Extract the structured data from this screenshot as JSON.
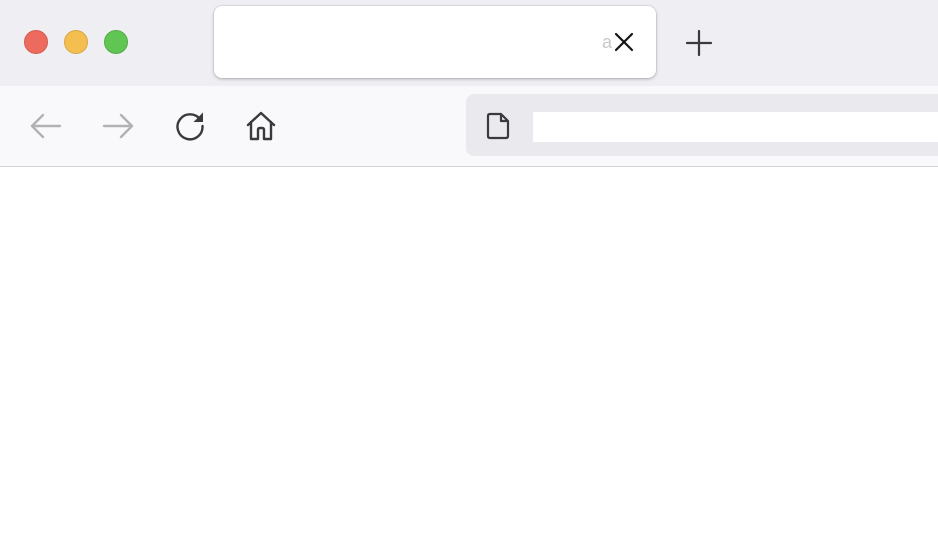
{
  "window": {
    "controls": [
      "close",
      "minimize",
      "zoom"
    ],
    "colors": {
      "close": "#ec6a5e",
      "minimize": "#f4bf4f",
      "zoom": "#61c554"
    }
  },
  "tabs": [
    {
      "title": "a",
      "active": true,
      "close_icon": "close-icon"
    }
  ],
  "new_tab_icon": "plus-icon",
  "toolbar": {
    "back": {
      "icon": "arrow-left-icon",
      "enabled": false
    },
    "forward": {
      "icon": "arrow-right-icon",
      "enabled": false
    },
    "reload": {
      "icon": "reload-icon",
      "enabled": true
    },
    "home": {
      "icon": "home-icon",
      "enabled": true
    }
  },
  "address_bar": {
    "icon": "page-icon",
    "value": "",
    "placeholder": ""
  }
}
